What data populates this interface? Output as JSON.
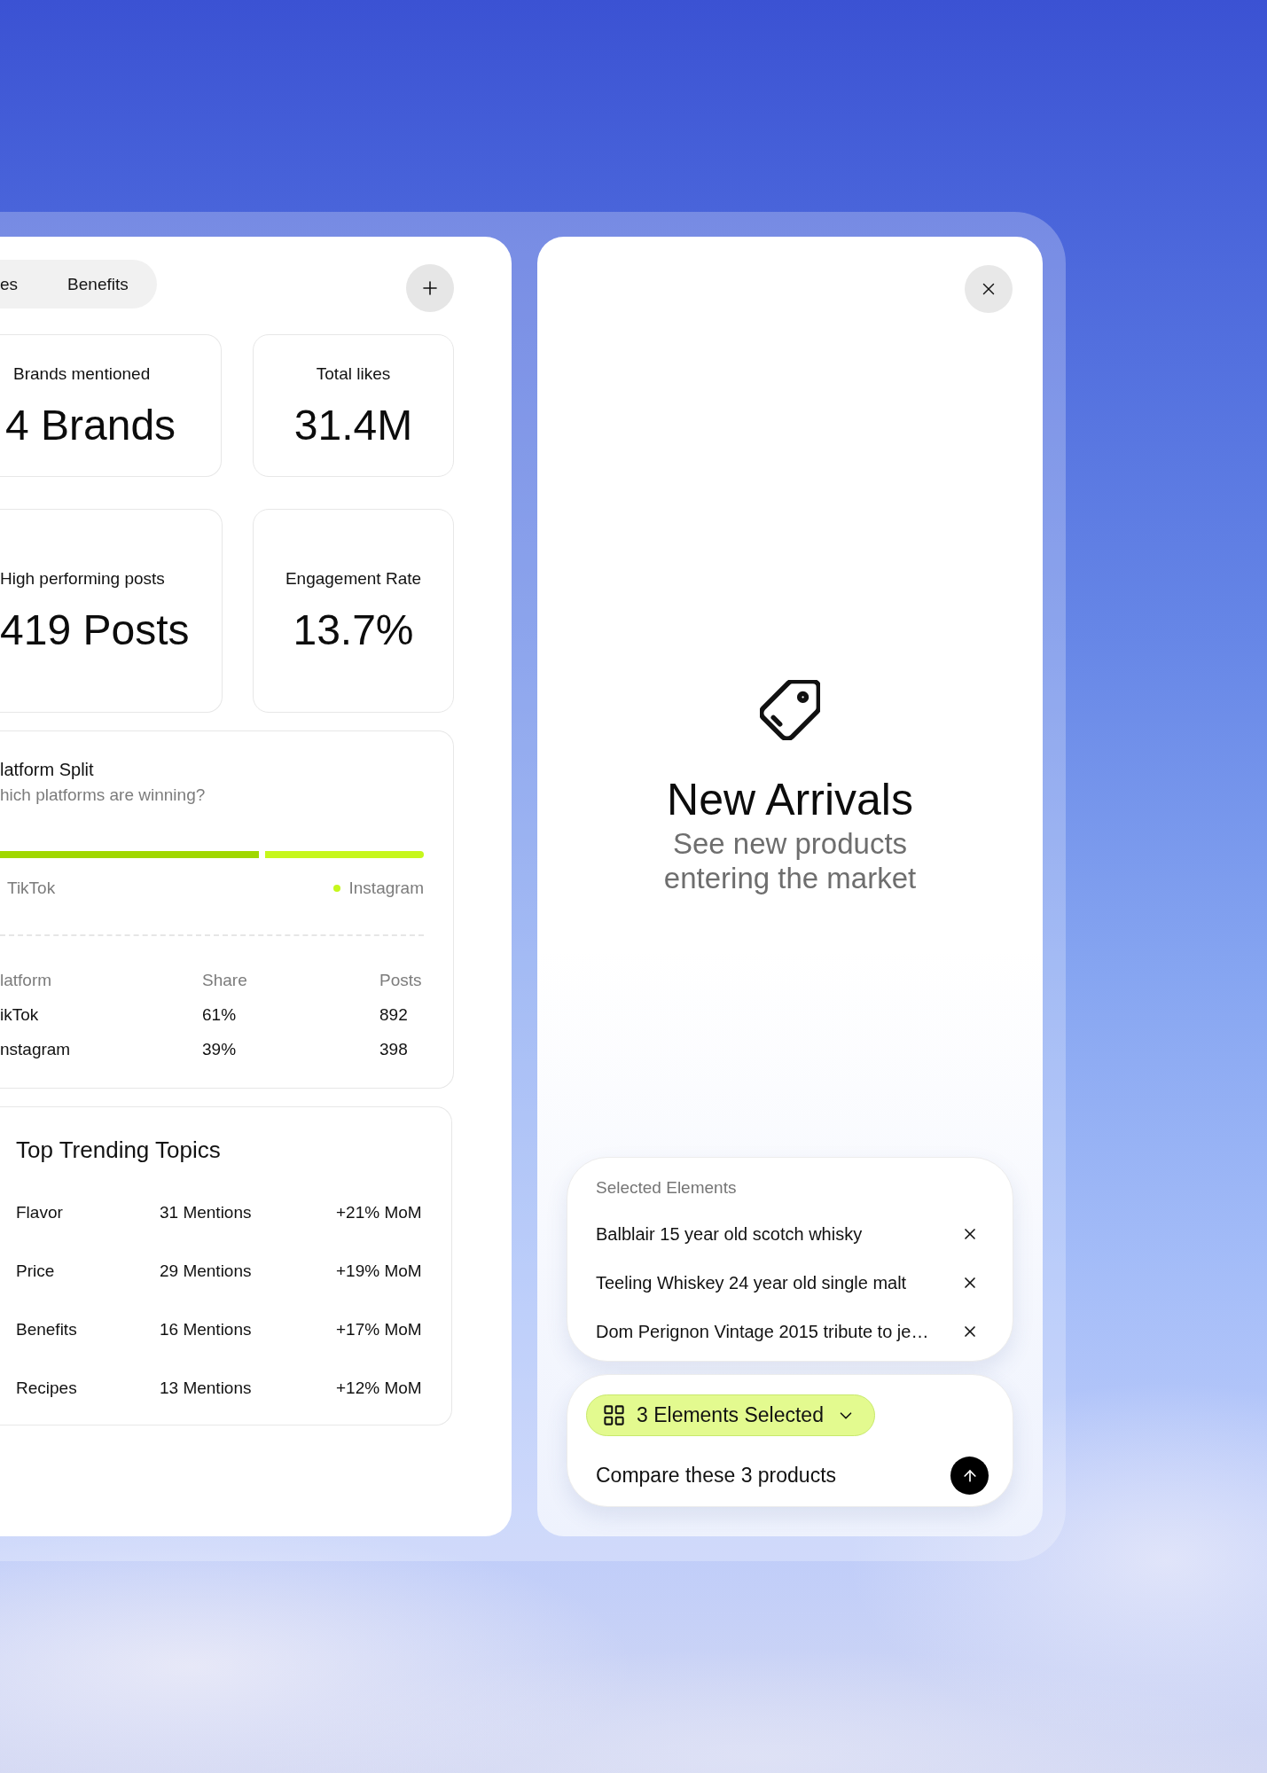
{
  "tabs": [
    {
      "label": "es",
      "selected": false
    },
    {
      "label": "Benefits",
      "selected": false
    }
  ],
  "stat_cards": [
    {
      "label": "Brands mentioned",
      "value": "4 Brands"
    },
    {
      "label": "Total likes",
      "value": "31.4M"
    },
    {
      "label": "High performing posts",
      "value": "419 Posts"
    },
    {
      "label": "Engagement Rate",
      "value": "13.7%"
    }
  ],
  "platform_split": {
    "title": "latform Split",
    "subtitle": "hich platforms are winning?",
    "share_bar": {
      "level": 0.61
    },
    "legend": [
      {
        "label": "TikTok",
        "dot": false
      },
      {
        "label": "Instagram",
        "dot": true,
        "color": "#c6f71c"
      }
    ],
    "table": {
      "columns": [
        "latform",
        "Share",
        "Posts"
      ],
      "rows": [
        [
          "ikTok",
          "61%",
          "892"
        ],
        [
          "nstagram",
          "39%",
          "398"
        ]
      ]
    }
  },
  "trending_topics": {
    "title": "Top Trending Topics",
    "rows": [
      {
        "topic": "Flavor",
        "mentions": "31 Mentions",
        "change": "+21% MoM"
      },
      {
        "topic": "Price",
        "mentions": "29 Mentions",
        "change": "+19% MoM"
      },
      {
        "topic": "Benefits",
        "mentions": "16 Mentions",
        "change": "+17% MoM"
      },
      {
        "topic": "Recipes",
        "mentions": "13 Mentions",
        "change": "+12% MoM"
      }
    ]
  },
  "new_arrivals": {
    "title": "New Arrivals",
    "subtitle": "See new products entering the market"
  },
  "selected_elements": {
    "title": "Selected Elements",
    "items": [
      "Balblair 15 year old scotch whisky",
      "Teeling Whiskey 24 year old single malt",
      "Dom Perignon Vintage 2015 tribute to je…"
    ]
  },
  "composer": {
    "chip": "3 Elements Selected",
    "value": "Compare these 3 products"
  }
}
